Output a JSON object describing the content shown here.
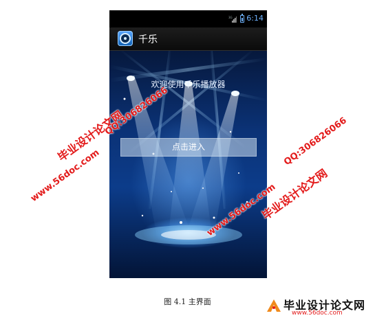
{
  "status_bar": {
    "network": "3G",
    "time": "6:14"
  },
  "action_bar": {
    "title": "千乐",
    "icon": "music-disc-icon"
  },
  "main": {
    "welcome": "欢迎使用千乐播放器",
    "enter_button": "点击进入"
  },
  "caption": "图 4.1 主界面",
  "watermarks": {
    "site_cn": "毕业设计论文网",
    "url": "www.56doc.com",
    "qq": "QQ:306826066"
  },
  "logo": {
    "title": "毕业设计论文网",
    "url": "www.56doc.com"
  },
  "colors": {
    "accent": "#6fb3ff",
    "watermark": "#e31b1b",
    "stage_dark": "#06183c",
    "stage_light": "#0c3c8a"
  }
}
